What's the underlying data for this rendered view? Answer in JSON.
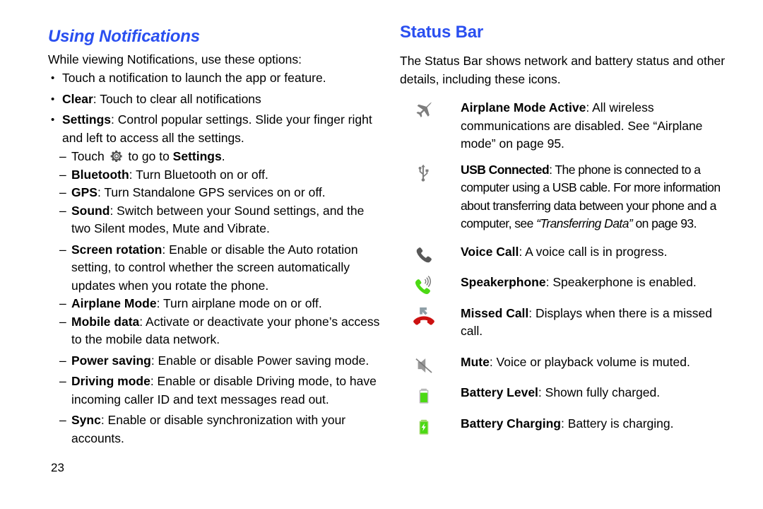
{
  "theme": {
    "heading_color": "#2a4ff0",
    "text_color": "#000000",
    "icon_gray": "#7d7d7d",
    "icon_dark_gray": "#5a5a5a",
    "icon_green": "#4cd914",
    "icon_red": "#cc1111"
  },
  "page_number": "23",
  "left_column": {
    "heading": "Using Notifications",
    "intro": "While viewing Notifications, use these options:",
    "bullets": [
      {
        "mark": "•",
        "bold": "",
        "text": "Touch a notification to launch the app or feature."
      },
      {
        "mark": "•",
        "bold": "Clear",
        "text": ": Touch to clear all notifications"
      },
      {
        "mark": "•",
        "bold": "Settings",
        "text": ": Control popular settings. Slide your finger right and left to access all the settings."
      }
    ],
    "sub_items": [
      {
        "mark": "–",
        "kind": "gear",
        "before": "Touch ",
        "icon": "gear-icon",
        "after_plain": " to go to ",
        "after_bold": "Settings",
        "after_tail": "."
      },
      {
        "mark": "–",
        "bold": "Bluetooth",
        "text": ": Turn Bluetooth on or off."
      },
      {
        "mark": "–",
        "bold": "GPS",
        "text": ": Turn Standalone GPS services on or off."
      },
      {
        "mark": "–",
        "bold": "Sound",
        "text": ": Switch between your Sound settings, and the two Silent modes, Mute and Vibrate."
      },
      {
        "mark": "–",
        "bold": "Screen rotation",
        "text": ": Enable or disable the Auto rotation setting, to control whether the screen automatically updates when you rotate the phone."
      },
      {
        "mark": "–",
        "bold": "Airplane Mode",
        "text": ": Turn airplane mode on or off."
      },
      {
        "mark": "–",
        "bold": "Mobile data",
        "text": ": Activate or deactivate your phone’s access to the mobile data network."
      },
      {
        "mark": "–",
        "bold": "Power saving",
        "text": ": Enable or disable Power saving mode."
      },
      {
        "mark": "–",
        "bold": "Driving mode",
        "text": ": Enable or disable Driving mode, to have incoming caller ID and text messages read out."
      },
      {
        "mark": "–",
        "bold": "Sync",
        "text": ": Enable or disable synchronization with your accounts."
      }
    ]
  },
  "right_column": {
    "heading": "Status Bar",
    "intro": "The Status Bar shows network and battery status and other details, including these icons.",
    "icons": [
      {
        "icon": "airplane-icon",
        "bold": "Airplane Mode Active",
        "text": ": All wireless communications are disabled. See “Airplane mode” on page 95."
      },
      {
        "icon": "usb-icon",
        "bold": "USB Connected",
        "text_before": ": The phone is connected to a computer using a USB cable. For more information about transferring data between your phone and a computer, see ",
        "italic": "“Transferring Data”",
        "text_after": " on page 93."
      },
      {
        "icon": "voice-call-icon",
        "bold": "Voice Call",
        "text": ": A voice call is in progress."
      },
      {
        "icon": "speakerphone-icon",
        "bold": "Speakerphone",
        "text": ": Speakerphone is enabled."
      },
      {
        "icon": "missed-call-icon",
        "bold": "Missed Call",
        "text": ": Displays when there is a missed call."
      },
      {
        "icon": "mute-icon",
        "bold": "Mute",
        "text": ": Voice or playback volume is muted."
      },
      {
        "icon": "battery-level-icon",
        "bold": "Battery Level",
        "text": ": Shown fully charged."
      },
      {
        "icon": "battery-charging-icon",
        "bold": "Battery Charging",
        "text": ": Battery is charging."
      }
    ]
  }
}
